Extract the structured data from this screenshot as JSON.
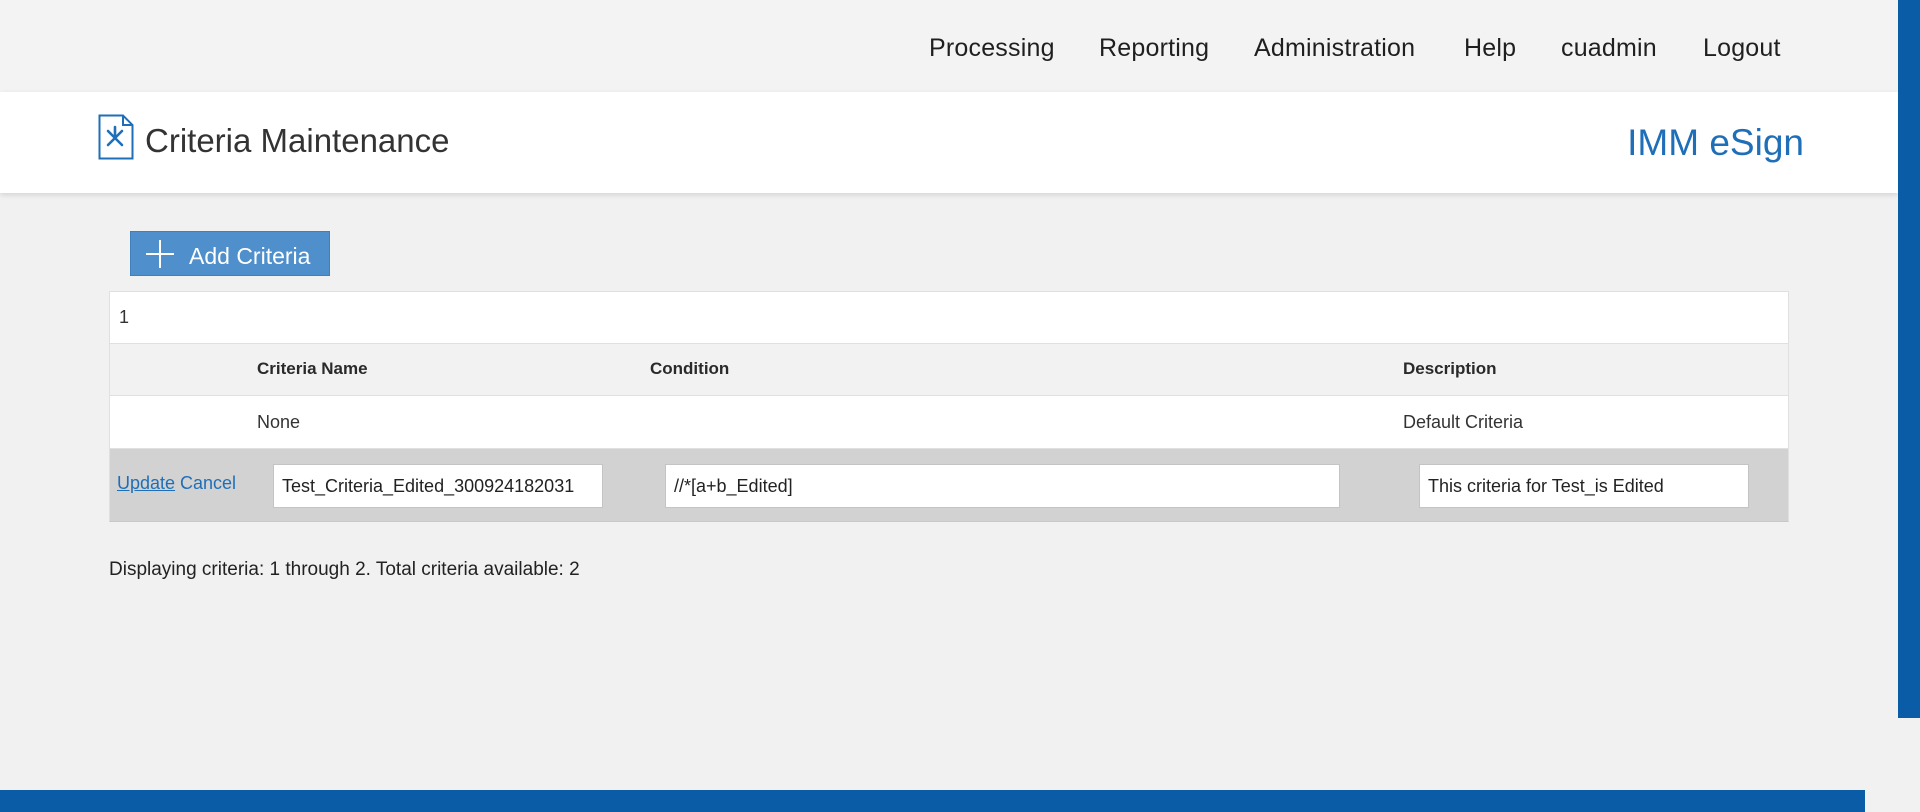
{
  "nav": {
    "items": [
      "Processing",
      "Reporting",
      "Administration",
      "Help",
      "cuadmin",
      "Logout"
    ]
  },
  "header": {
    "title": "Criteria Maintenance",
    "brand": "IMM eSign"
  },
  "toolbar": {
    "add_label": "Add Criteria"
  },
  "grid": {
    "pager": "1",
    "columns": {
      "name": "Criteria Name",
      "condition": "Condition",
      "description": "Description"
    },
    "rows": [
      {
        "name": "None",
        "condition": "",
        "description": "Default Criteria"
      }
    ],
    "edit_row": {
      "update_label": "Update",
      "cancel_label": "Cancel",
      "name_value": "Test_Criteria_Edited_300924182031",
      "condition_value": "//*[a+b_Edited]",
      "description_value": "This criteria for Test_is Edited"
    }
  },
  "summary": "Displaying criteria: 1 through 2. Total criteria available: 2",
  "colors": {
    "accent": "#1f6fb8",
    "button": "#4f8fcb",
    "footer": "#0a5ca6"
  },
  "icons": [
    "document-tools-icon",
    "plus-icon"
  ]
}
